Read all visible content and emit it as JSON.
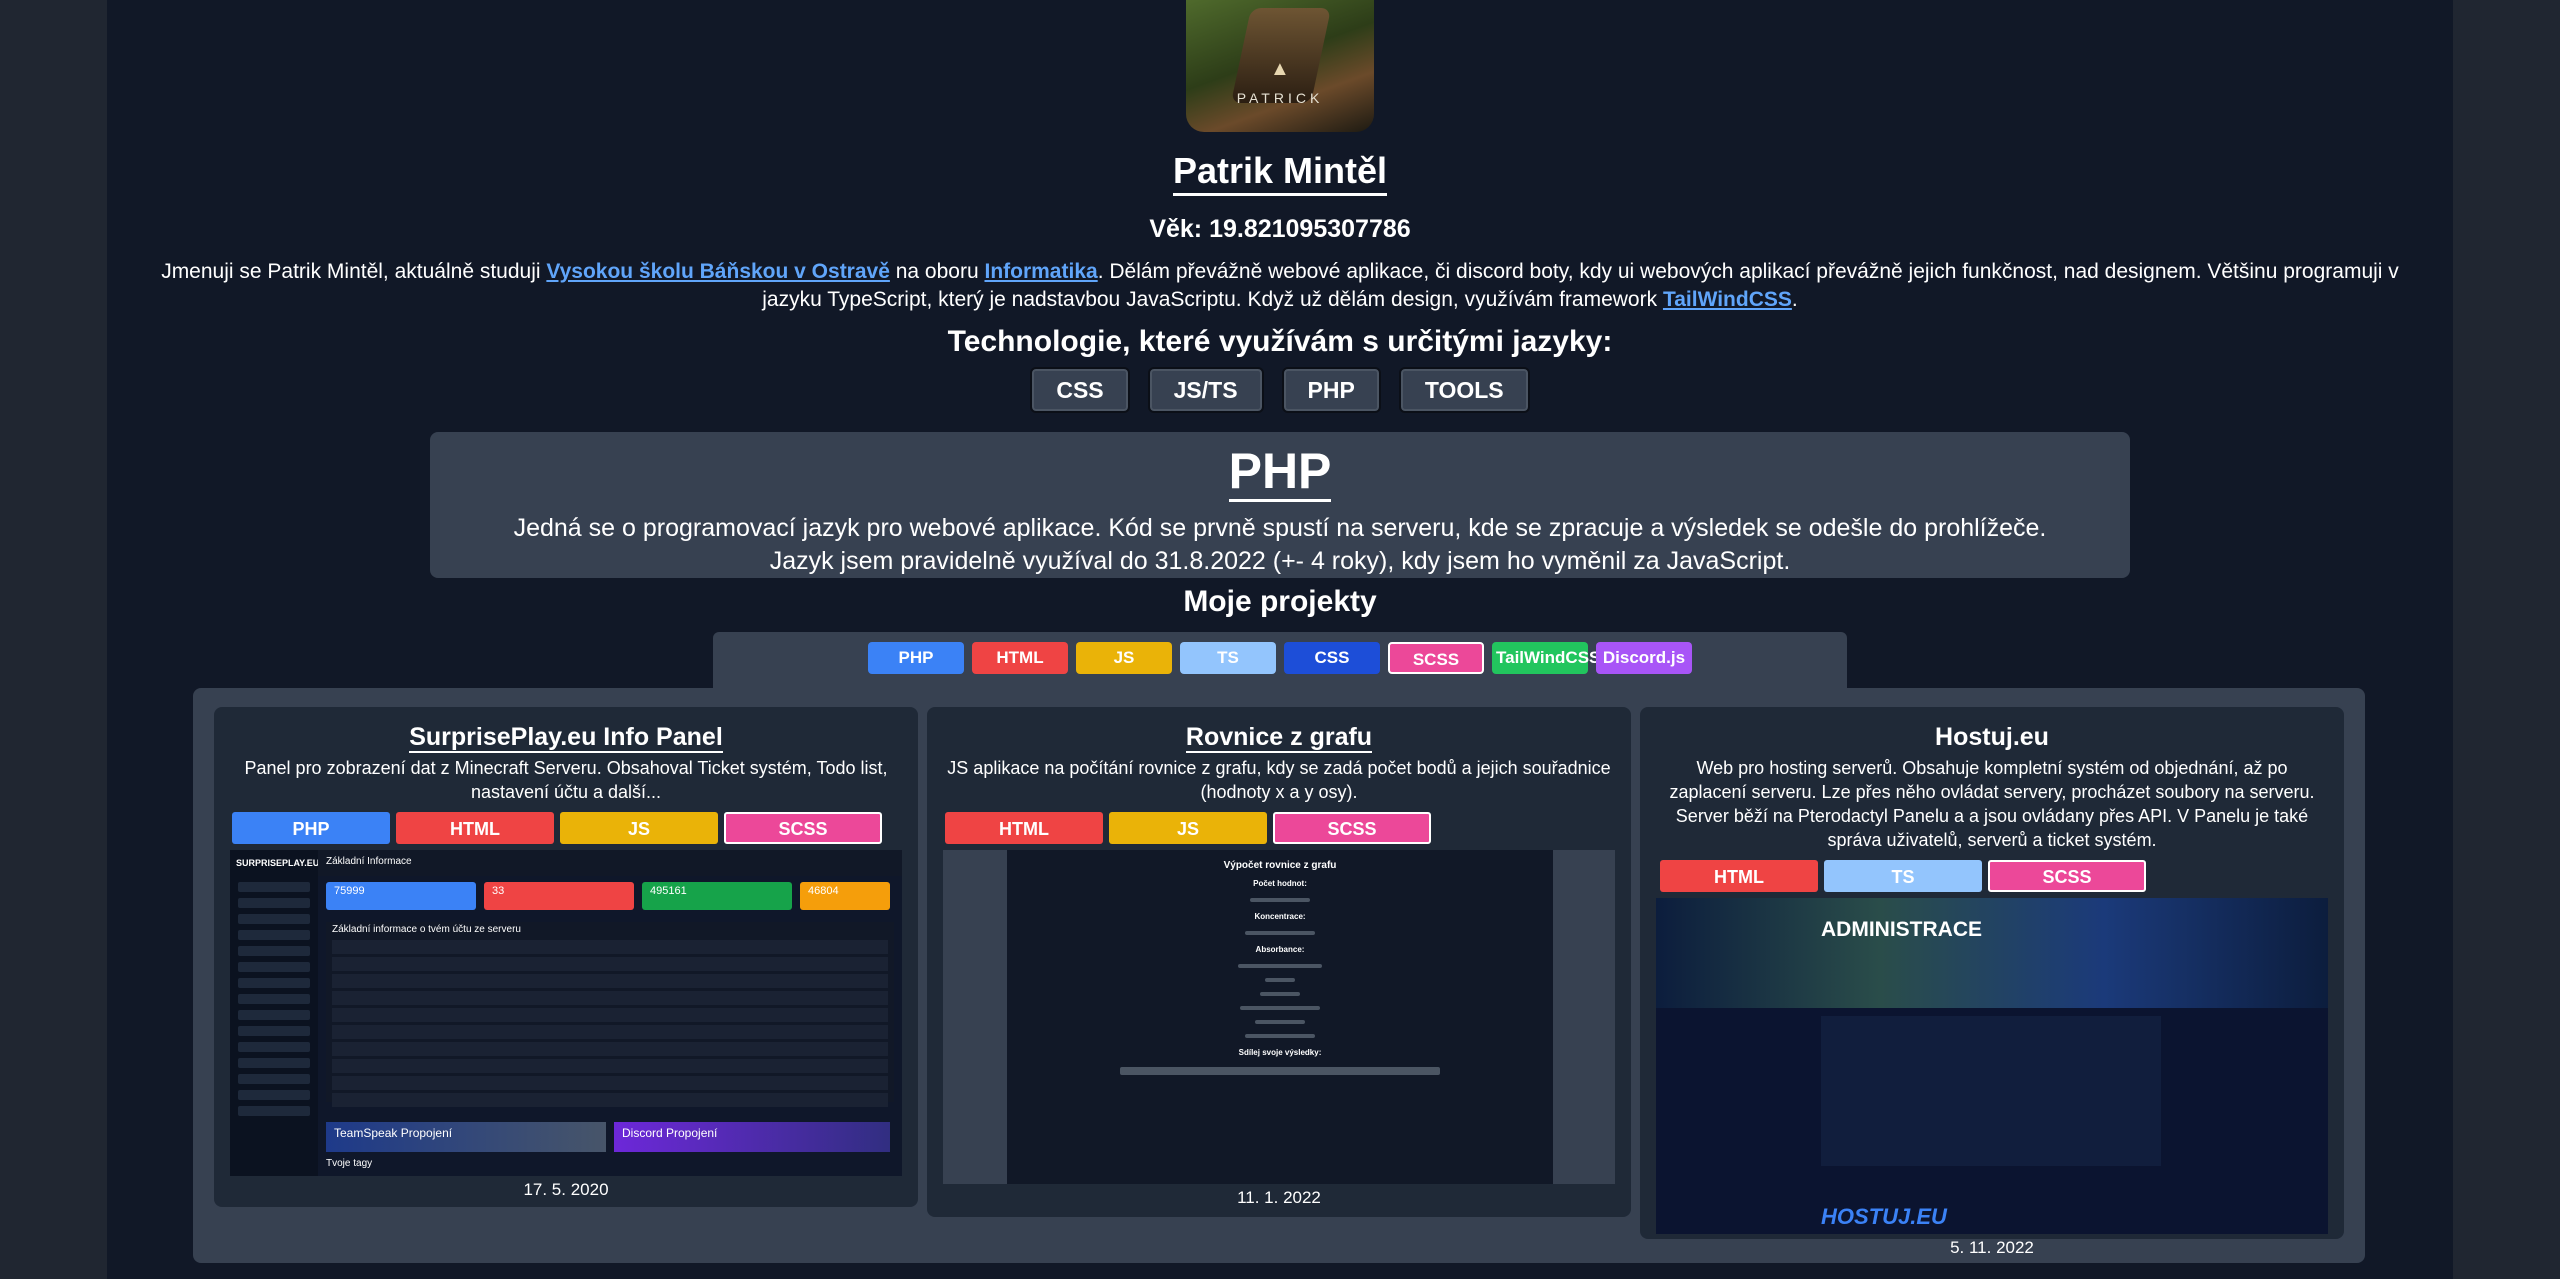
{
  "profile": {
    "avatar_label": "PATRICK",
    "name": "Patrik Mintěl",
    "age": "Věk: 19.821095307786",
    "bio": {
      "p1": "Jmenuji se Patrik Mintěl, aktuálně studuji ",
      "link1": "Vysokou školu Báňskou v Ostravě",
      "p2": " na oboru ",
      "link2": "Informatika",
      "p3": ". Dělám převážně webové aplikace, či discord boty, kdy ui webových aplikací převážně jejich funkčnost, nad designem. Většinu programuji v jazyku TypeScript, který je nadstavbou JavaScriptu. Když už dělám design, využívám framework ",
      "link3": "TailWindCSS",
      "p4": "."
    }
  },
  "technologies": {
    "heading": "Technologie, které využívám s určitými jazyky:",
    "tabs": [
      "CSS",
      "JS/TS",
      "PHP",
      "TOOLS"
    ],
    "selected": {
      "title": "PHP",
      "description": "Jedná se o programovací jazyk pro webové aplikace. Kód se prvně spustí na serveru, kde se zpracuje a výsledek se odešle do prohlížeče. Jazyk jsem pravidelně využíval do 31.8.2022 (+- 4 roky), kdy jsem ho vyměnil za JavaScript."
    }
  },
  "projects": {
    "heading": "Moje projekty",
    "filters": [
      {
        "label": "PHP",
        "color": "#3b82f6"
      },
      {
        "label": "HTML",
        "color": "#ef4444"
      },
      {
        "label": "JS",
        "color": "#eab308"
      },
      {
        "label": "TS",
        "color": "#93c5fd"
      },
      {
        "label": "CSS",
        "color": "#1d4ed8"
      },
      {
        "label": "SCSS",
        "color": "#ec4899"
      },
      {
        "label": "TailWindCSS",
        "color": "#22c55e"
      },
      {
        "label": "Discord.js",
        "color": "#a855f7"
      }
    ],
    "items": [
      {
        "title": "SurprisePlay.eu Info Panel",
        "description": "Panel pro zobrazení dat z Minecraft Serveru. Obsahoval Ticket systém, Todo list, nastavení účtu a další...",
        "tags": [
          "PHP",
          "HTML",
          "JS",
          "SCSS"
        ],
        "date": "17. 5. 2020",
        "screenshot": {
          "logo": "SURPRISEPLAY.EU",
          "section": "Základní Informace",
          "stats": [
            "75999",
            "33",
            "495161",
            "46804"
          ],
          "table_title": "Základní informace o tvém účtu ze serveru",
          "teamspeak": "TeamSpeak Propojení",
          "discord": "Discord Propojení",
          "footer": "Tvoje tagy"
        }
      },
      {
        "title": "Rovnice z grafu",
        "description": "JS aplikace na počítání rovnice z grafu, kdy se zadá počet bodů a jejich souřadnice (hodnoty x a y osy).",
        "tags": [
          "HTML",
          "JS",
          "SCSS"
        ],
        "date": "11. 1. 2022",
        "screenshot": {
          "title": "Výpočet rovnice z grafu",
          "label1": "Počet hodnot:",
          "label2": "Koncentrace:",
          "label3": "Absorbance:",
          "label4": "Sdílej svoje výsledky:"
        }
      },
      {
        "title": "Hostuj.eu",
        "description": "Web pro hosting serverů. Obsahuje kompletní systém od objednání, až po zaplacení serveru. Lze přes něho ovládat servery, procházet soubory na serveru. Server běží na Pterodactyl Panelu a a jsou ovládany přes API. V Panelu je také správa uživatelů, serverů a ticket systém.",
        "tags": [
          "HTML",
          "TS",
          "SCSS"
        ],
        "date": "5. 11. 2022",
        "screenshot": {
          "banner": "ADMINISTRACE",
          "logo": "HOSTUJ.EU"
        }
      }
    ]
  },
  "colors": {
    "page_bg": "#111827",
    "card_bg": "#1f2937",
    "panel_bg": "#374151",
    "link": "#60a5fa",
    "php": "#3b82f6",
    "html": "#ef4444",
    "js": "#eab308",
    "ts": "#93c5fd",
    "scss": "#ec4899"
  }
}
